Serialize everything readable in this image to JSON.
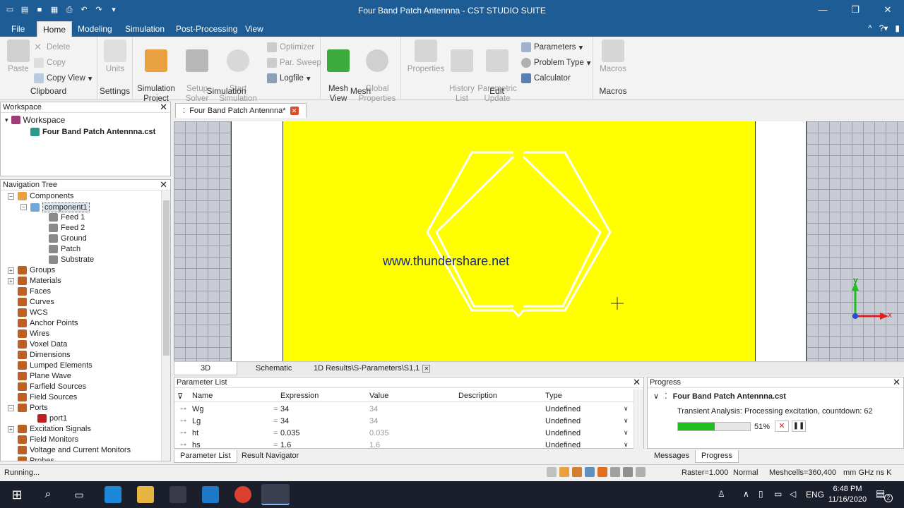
{
  "window": {
    "title": "Four Band Patch Antennna - CST STUDIO SUITE"
  },
  "tabs": [
    "File",
    "Home",
    "Modeling",
    "Simulation",
    "Post-Processing",
    "View"
  ],
  "ribbon": {
    "clipboard": {
      "label": "Clipboard",
      "paste": "Paste",
      "delete": "Delete",
      "copy": "Copy",
      "copy_view": "Copy View"
    },
    "settings": {
      "label": "Settings",
      "units": "Units"
    },
    "simulation": {
      "label": "Simulation",
      "simulation_project": "Simulation\nProject",
      "setup_solver": "Setup\nSolver",
      "start_simulation": "Start\nSimulation",
      "optimizer": "Optimizer",
      "par_sweep": "Par. Sweep",
      "logfile": "Logfile"
    },
    "mesh": {
      "label": "Mesh",
      "mesh_view": "Mesh\nView",
      "global_properties": "Global\nProperties"
    },
    "edit": {
      "label": "Edit",
      "properties": "Properties",
      "history_list": "History\nList",
      "parametric_update": "Parametric\nUpdate",
      "parameters": "Parameters",
      "problem_type": "Problem Type",
      "calculator": "Calculator"
    },
    "macros": {
      "label": "Macros",
      "macros": "Macros"
    }
  },
  "workspace": {
    "header": "Workspace",
    "root": "Workspace",
    "file": "Four Band Patch Antennna.cst"
  },
  "navtree": {
    "header": "Navigation Tree",
    "components": "Components",
    "component1": "component1",
    "children": [
      "Feed 1",
      "Feed 2",
      "Ground",
      "Patch",
      "Substrate"
    ],
    "groups": [
      "Groups",
      "Materials",
      "Faces",
      "Curves",
      "WCS",
      "Anchor Points",
      "Wires",
      "Voxel Data",
      "Dimensions",
      "Lumped Elements",
      "Plane Wave",
      "Farfield Sources",
      "Field Sources",
      "Ports"
    ],
    "port1": "port1",
    "after": [
      "Excitation Signals",
      "Field Monitors",
      "Voltage and Current Monitors",
      "Probes"
    ]
  },
  "doc_tab": "Four Band Patch Antennna*",
  "watermark": "www.thundershare.net",
  "axes": {
    "y": "y",
    "x": "x"
  },
  "view_tabs": [
    "3D",
    "Schematic",
    "1D Results\\S-Parameters\\S1,1"
  ],
  "parameter_list": {
    "header": "Parameter List",
    "columns": [
      "Name",
      "Expression",
      "Value",
      "Description",
      "Type"
    ],
    "rows": [
      {
        "name": "Wg",
        "eq": "=",
        "expr": "34",
        "value": "34",
        "type": "Undefined"
      },
      {
        "name": "Lg",
        "eq": "=",
        "expr": "34",
        "value": "34",
        "type": "Undefined"
      },
      {
        "name": "ht",
        "eq": "=",
        "expr": "0.035",
        "value": "0.035",
        "type": "Undefined"
      },
      {
        "name": "hs",
        "eq": "=",
        "expr": "1.6",
        "value": "1.6",
        "type": "Undefined"
      }
    ]
  },
  "bottom_tabs": [
    "Parameter List",
    "Result Navigator"
  ],
  "progress": {
    "header": "Progress",
    "project": "Four Band Patch Antennna.cst",
    "task": "Transient Analysis: Processing excitation, countdown: 62",
    "percent_text": "51%",
    "percent": 51
  },
  "progress_tabs": [
    "Messages",
    "Progress"
  ],
  "status": {
    "left": "Running...",
    "raster": "Raster=1.000",
    "mode": "Normal",
    "meshcells": "Meshcells=360,400",
    "units": "mm  GHz  ns  K"
  },
  "taskbar": {
    "lang": "ENG",
    "time": "6:48 PM",
    "date": "11/16/2020",
    "badge": "2"
  },
  "colors": {
    "titlebar": "#1e5c96",
    "patch": "#ffff00",
    "grid": "#c9ccd4",
    "progress": "#1fbf1f"
  }
}
